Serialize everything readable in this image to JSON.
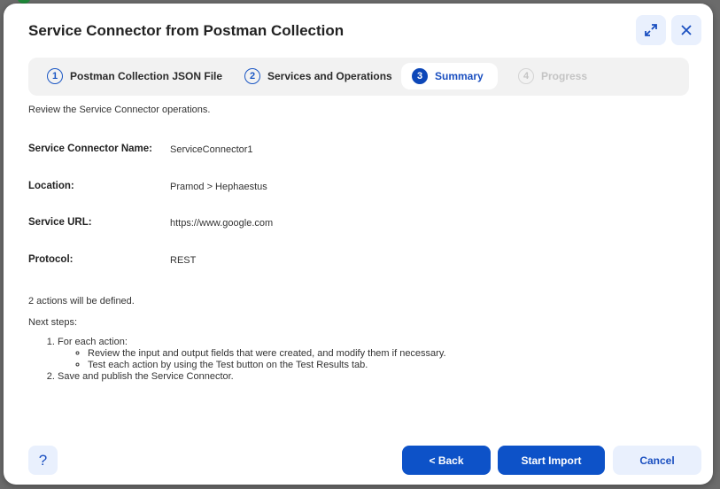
{
  "dialog": {
    "title": "Service Connector from Postman Collection",
    "expand_icon": "expand-icon",
    "close_icon": "close-icon"
  },
  "stepper": {
    "steps": [
      {
        "number": "1",
        "label": "Postman Collection JSON File",
        "state": "completed"
      },
      {
        "number": "2",
        "label": "Services and Operations",
        "state": "completed"
      },
      {
        "number": "3",
        "label": "Summary",
        "state": "active"
      },
      {
        "number": "4",
        "label": "Progress",
        "state": "disabled"
      }
    ]
  },
  "summary": {
    "intro": "Review the Service Connector operations.",
    "fields": [
      {
        "label": "Service Connector Name:",
        "value": "ServiceConnector1"
      },
      {
        "label": "Location:",
        "value": "Pramod > Hephaestus"
      },
      {
        "label": "Service URL:",
        "value": "https://www.google.com"
      },
      {
        "label": "Protocol:",
        "value": "REST"
      }
    ],
    "actions_note": "2 actions will be defined.",
    "next_steps_heading": "Next steps:",
    "next_steps": {
      "step1": "For each action:",
      "step1_sub": [
        "Review the input and output fields that were created, and modify them if necessary.",
        "Test each action by using the Test button on the Test Results tab."
      ],
      "step2": "Save and publish the Service Connector."
    }
  },
  "footer": {
    "help_label": "?",
    "back_label": "< Back",
    "start_import_label": "Start Import",
    "cancel_label": "Cancel"
  },
  "colors": {
    "primary": "#0d52c8",
    "primary_light": "#e9f0fd",
    "stepper_bg": "#f2f2f2",
    "disabled_text": "#c4c4c4"
  }
}
